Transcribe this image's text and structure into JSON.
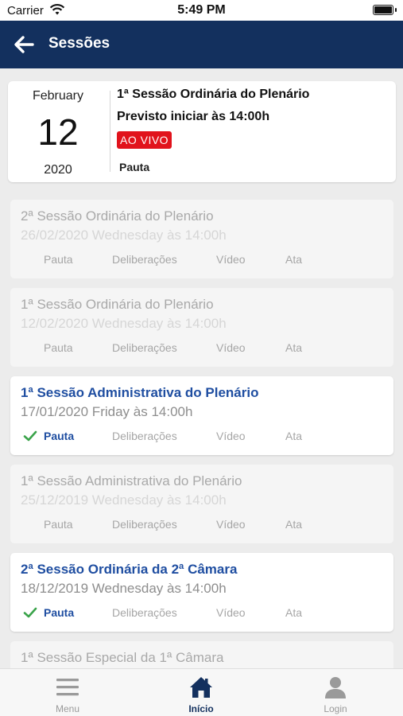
{
  "status": {
    "carrier": "Carrier",
    "time": "5:49 PM"
  },
  "header": {
    "title": "Sessões"
  },
  "live_session": {
    "month": "February",
    "day": "12",
    "year": "2020",
    "title": "1ª Sessão Ordinária do Plenário",
    "subtitle": "Previsto iniciar às 14:00h",
    "badge": "AO VIVO",
    "pauta": "Pauta"
  },
  "actions": {
    "pauta": "Pauta",
    "deliberacoes": "Deliberações",
    "video": "Vídeo",
    "ata": "Ata"
  },
  "sessions": [
    {
      "title": "2ª Sessão Ordinária do Plenário",
      "date": "26/02/2020 Wednesday às 14:00h",
      "active": false
    },
    {
      "title": "1ª Sessão Ordinária do Plenário",
      "date": "12/02/2020 Wednesday às 14:00h",
      "active": false
    },
    {
      "title": "1ª Sessão Administrativa do Plenário",
      "date": "17/01/2020 Friday às 14:00h",
      "active": true
    },
    {
      "title": "1ª Sessão Administrativa do Plenário",
      "date": "25/12/2019 Wednesday às 14:00h",
      "active": false
    },
    {
      "title": "2ª Sessão Ordinária da 2ª Câmara",
      "date": "18/12/2019 Wednesday às 14:00h",
      "active": true
    },
    {
      "title": "1ª Sessão Especial da 1ª Câmara",
      "date": "",
      "active": false
    }
  ],
  "tabbar": {
    "menu": "Menu",
    "inicio": "Início",
    "login": "Login",
    "selected": "inicio"
  },
  "colors": {
    "header_bg": "#13305e",
    "live_badge": "#e1131c",
    "active_title": "#1f4ea1",
    "check": "#3aa34a"
  },
  "icons": {
    "back": "arrow-left-icon",
    "menu": "hamburger-icon",
    "inicio": "home-icon",
    "login": "user-icon",
    "pauta_done": "checkmark-icon"
  }
}
